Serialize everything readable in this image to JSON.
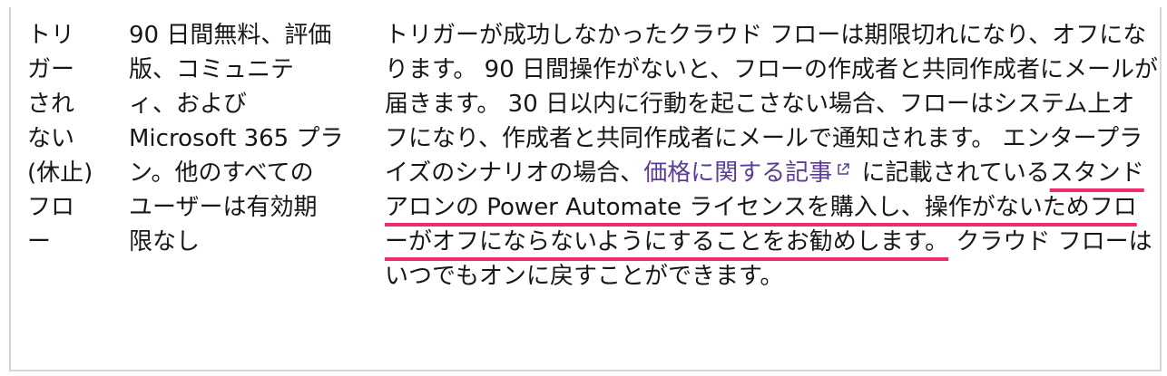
{
  "row": {
    "col1": "トリ\nガー\nされ\nない\n(休止)\nフロ\nー",
    "col2": "90 日間無料、評価\n版、コミュニテ\nィ、および\nMicrosoft 365 プラ\nン。他のすべての\nユーザーは有効期\n限なし",
    "col3": {
      "before_link": "トリガーが成功しなかったクラウド フローは期限切れになり、オフになります。 90 日間操作がないと、フローの作成者と共同作成者にメールが届きます。 30 日以内に行動を起こさない場合、フローはシステム上オフになり、作成者と共同作成者にメールで通知されます。 エンタープライズのシナリオの場合、",
      "link_text": "価格に関する記事",
      "after_link": " に記載されている",
      "highlighted": "スタンドアロンの Power Automate ライセンスを購入し、操作がないためフローがオフにならないようにすることをお勧めします。",
      "tail": " クラウド フローはいつでもオンに戻すことができます。"
    }
  },
  "colors": {
    "text": "#171717",
    "link": "#5b3c97",
    "underline_highlight": "#ec2c6c",
    "border": "#d6d6d6"
  },
  "icons": {
    "link": "external-link-icon"
  }
}
